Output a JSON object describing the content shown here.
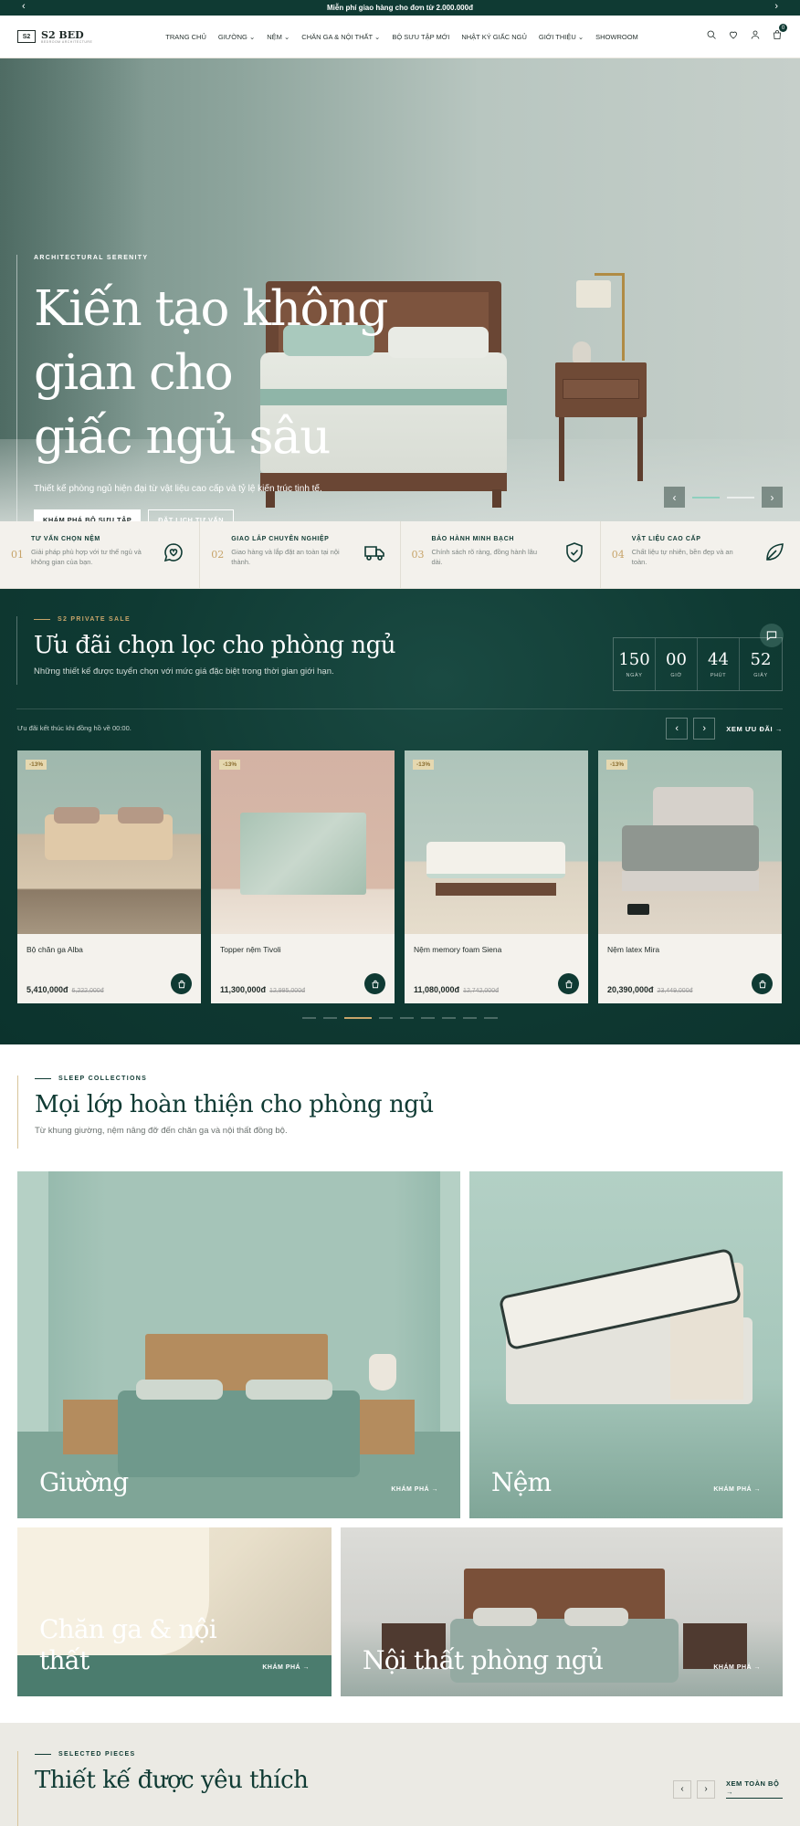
{
  "announcement": {
    "text": "Miễn phí giao hàng cho đơn từ 2.000.000đ",
    "prev": "‹",
    "next": "›"
  },
  "brand": {
    "mark": "S2",
    "name": "S2 BED",
    "tagline": "BEDROOM ARCHITECTURE"
  },
  "nav": [
    "TRANG CHỦ",
    "GIƯỜNG ⌄",
    "NỆM ⌄",
    "CHĂN GA & NỘI THẤT ⌄",
    "BỘ SƯU TẬP MỚI",
    "NHẬT KÝ GIẤC NGỦ",
    "GIỚI THIỆU ⌄",
    "SHOWROOM"
  ],
  "header_icons": [
    "search-icon",
    "heart-icon",
    "user-icon",
    "cart-icon"
  ],
  "cart_count": "0",
  "hero": {
    "eyebrow": "ARCHITECTURAL SERENITY",
    "title_lines": [
      "Kiến tạo không",
      "gian cho",
      "giấc ngủ sâu"
    ],
    "subtitle": "Thiết kế phòng ngủ hiện đại từ vật liệu cao cấp và tỷ lệ kiến trúc tinh tế.",
    "cta_primary": "KHÁM PHÁ BỘ SƯU TẬP",
    "cta_secondary": "ĐẶT LỊCH TƯ VẤN",
    "prev": "‹",
    "next": "›"
  },
  "features": [
    {
      "num": "01",
      "title": "TƯ VẤN CHỌN NỆM",
      "desc": "Giải pháp phù hợp với tư thế ngủ và không gian của bạn.",
      "icon": "chat-heart-icon"
    },
    {
      "num": "02",
      "title": "GIAO LẮP CHUYÊN NGHIỆP",
      "desc": "Giao hàng và lắp đặt an toàn tại nội thành.",
      "icon": "truck-icon"
    },
    {
      "num": "03",
      "title": "BẢO HÀNH MINH BẠCH",
      "desc": "Chính sách rõ ràng, đồng hành lâu dài.",
      "icon": "shield-check-icon"
    },
    {
      "num": "04",
      "title": "VẬT LIỆU CAO CẤP",
      "desc": "Chất liệu tự nhiên, bền đẹp và an toàn.",
      "icon": "leaf-icon"
    }
  ],
  "sale": {
    "eyebrow": "S2 PRIVATE SALE",
    "title": "Ưu đãi chọn lọc cho phòng ngủ",
    "subtitle": "Những thiết kế được tuyển chọn với mức giá đặc biệt trong thời gian giới hạn.",
    "countdown": [
      {
        "value": "150",
        "label": "NGÀY"
      },
      {
        "value": "00",
        "label": "GIỜ"
      },
      {
        "value": "44",
        "label": "PHÚT"
      },
      {
        "value": "52",
        "label": "GIÂY"
      }
    ],
    "note": "Ưu đãi kết thúc khi đồng hồ về 00:00.",
    "view_all": "XEM ƯU ĐÃI →",
    "prev": "‹",
    "next": "›",
    "products": [
      {
        "discount": "-13%",
        "name": "Bộ chăn ga Alba",
        "price": "5,410,000đ",
        "old_price": "6,222,000đ"
      },
      {
        "discount": "-13%",
        "name": "Topper nệm Tivoli",
        "price": "11,300,000đ",
        "old_price": "12,995,000đ"
      },
      {
        "discount": "-13%",
        "name": "Nệm memory foam Siena",
        "price": "11,080,000đ",
        "old_price": "12,742,000đ"
      },
      {
        "discount": "-13%",
        "name": "Nệm latex Mira",
        "price": "20,390,000đ",
        "old_price": "23,449,000đ"
      }
    ],
    "pager_count": 9,
    "pager_active": 2
  },
  "collections": {
    "eyebrow": "SLEEP COLLECTIONS",
    "title": "Mọi lớp hoàn thiện cho phòng ngủ",
    "subtitle": "Từ khung giường, nệm nâng đỡ đến chăn ga và nội thất đồng bộ.",
    "tiles": [
      {
        "label": "Giường",
        "cta": "KHÁM PHÁ →"
      },
      {
        "label": "Nệm",
        "cta": "KHÁM PHÁ →"
      },
      {
        "label": "Chăn ga & nội thất",
        "cta": "KHÁM PHÁ →"
      },
      {
        "label": "Nội thất phòng ngủ",
        "cta": "KHÁM PHÁ →"
      }
    ]
  },
  "favorites": {
    "eyebrow": "SELECTED PIECES",
    "title": "Thiết kế được yêu thích",
    "view_all": "XEM TOÀN BỘ →",
    "prev": "‹",
    "next": "›"
  }
}
